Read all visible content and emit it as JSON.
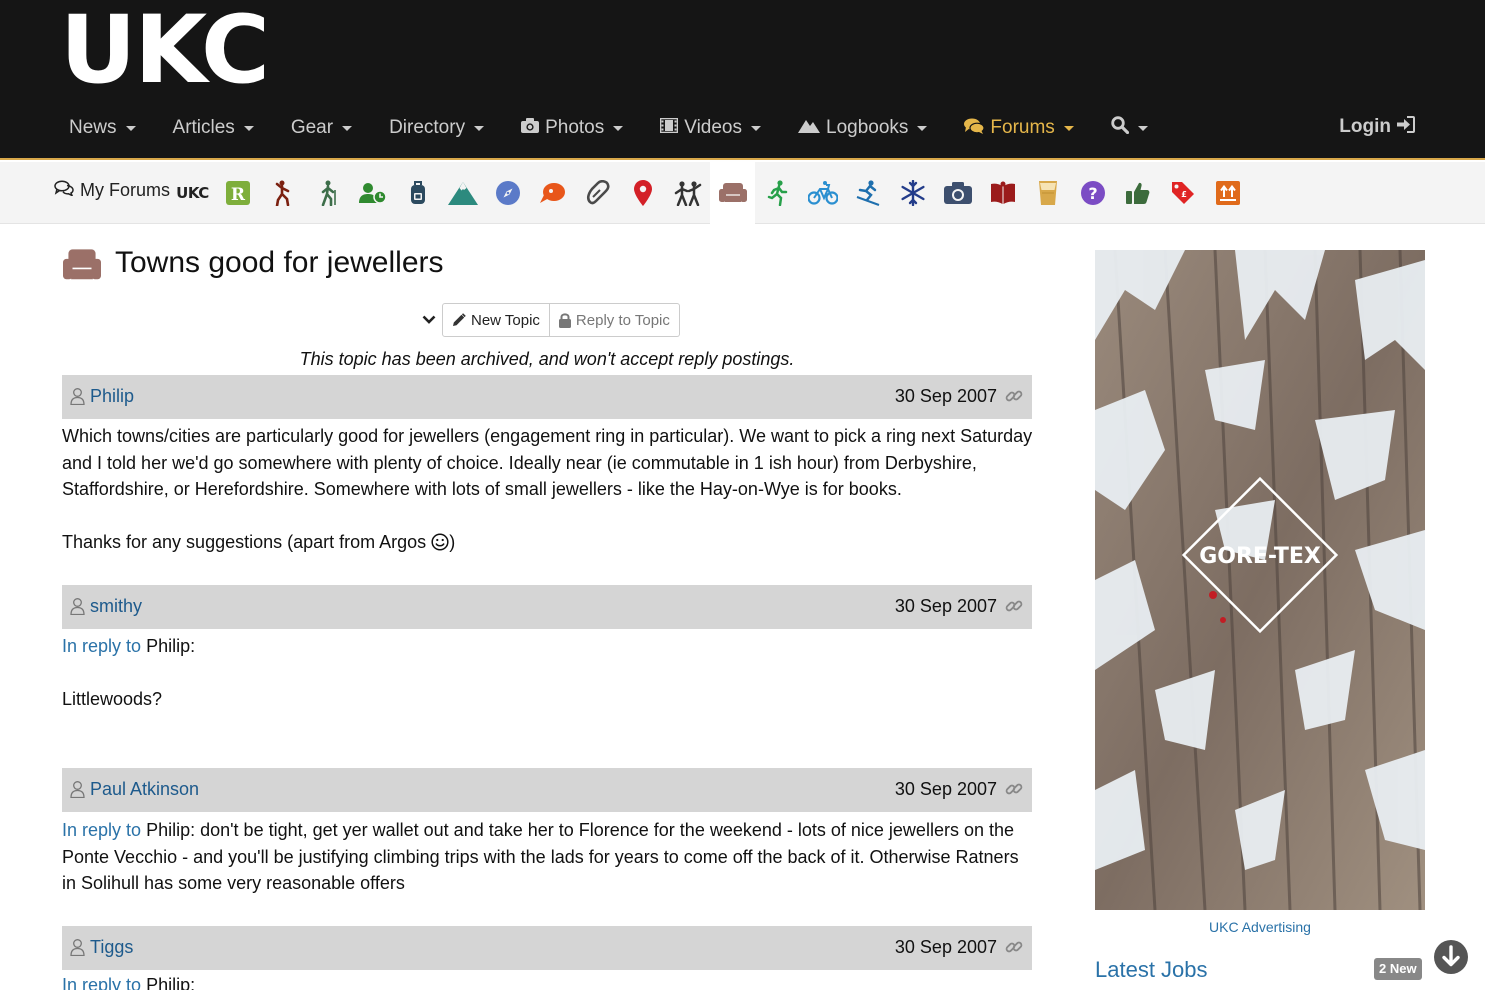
{
  "site": {
    "logo": "UKC"
  },
  "nav": {
    "items": [
      {
        "label": "News",
        "icon": ""
      },
      {
        "label": "Articles",
        "icon": ""
      },
      {
        "label": "Gear",
        "icon": ""
      },
      {
        "label": "Directory",
        "icon": ""
      },
      {
        "label": "Photos",
        "icon": "camera-icon"
      },
      {
        "label": "Videos",
        "icon": "film-icon"
      },
      {
        "label": "Logbooks",
        "icon": "mountain-icon"
      },
      {
        "label": "Forums",
        "icon": "comments-icon"
      }
    ],
    "active": "Forums",
    "login": "Login",
    "accent_color": "#e5b64a"
  },
  "forum_bar": {
    "my_forums": "My Forums",
    "ukc_label": "UKC",
    "icons": [
      "rockfax-icon",
      "climber-icon",
      "hiker-icon",
      "users-icon",
      "backpack-icon",
      "mountain-icon",
      "compass-icon",
      "speech-icon",
      "carabiner-icon",
      "map-pin-icon",
      "partners-icon",
      "sofa-icon",
      "runner-icon",
      "bike-icon",
      "skier-icon",
      "snowflake-icon",
      "camera-icon",
      "book-icon",
      "beer-icon",
      "question-icon",
      "thumbs-up-icon",
      "tag-icon",
      "upload-icon"
    ],
    "active_icon": "sofa-icon"
  },
  "topic": {
    "title": "Towns good for jewellers",
    "new_topic": "New Topic",
    "reply_to_topic": "Reply to Topic",
    "archived_notice": "This topic has been archived, and won't accept reply postings."
  },
  "posts": [
    {
      "author": "Philip",
      "date": "30 Sep 2007",
      "body_1": "Which towns/cities are particularly good for jewellers (engagement ring in particular). We want to pick a ring next Saturday and I told her we'd go somewhere with plenty of choice. Ideally near (ie commutable in 1 ish hour) from Derbyshire, Staffordshire, or Herefordshire. Somewhere with lots of small jewellers - like the Hay-on-Wye is for books.",
      "body_2": "Thanks for any suggestions (apart from Argos",
      "body_2_end": ")"
    },
    {
      "author": "smithy",
      "date": "30 Sep 2007",
      "in_reply_to": "In reply to",
      "reply_target": "Philip:",
      "body_1": "Littlewoods?"
    },
    {
      "author": "Paul Atkinson",
      "date": "30 Sep 2007",
      "in_reply_to": "In reply to",
      "body_1": "Philip: don't be tight, get yer wallet out and take her to Florence for the weekend - lots of nice jewellers on the Ponte Vecchio - and you'll be justifying climbing trips with the lads for years to come off the back of it. Otherwise Ratners in Solihull has some very reasonable offers"
    },
    {
      "author": "Tiggs",
      "date": "30 Sep 2007",
      "in_reply_to": "In reply to",
      "reply_target": "Philip:"
    }
  ],
  "sidebar": {
    "ad_logo": "GORE-TEX",
    "ad_caption": "UKC Advertising",
    "latest_jobs": "Latest Jobs",
    "jobs_badge": "2 New"
  }
}
